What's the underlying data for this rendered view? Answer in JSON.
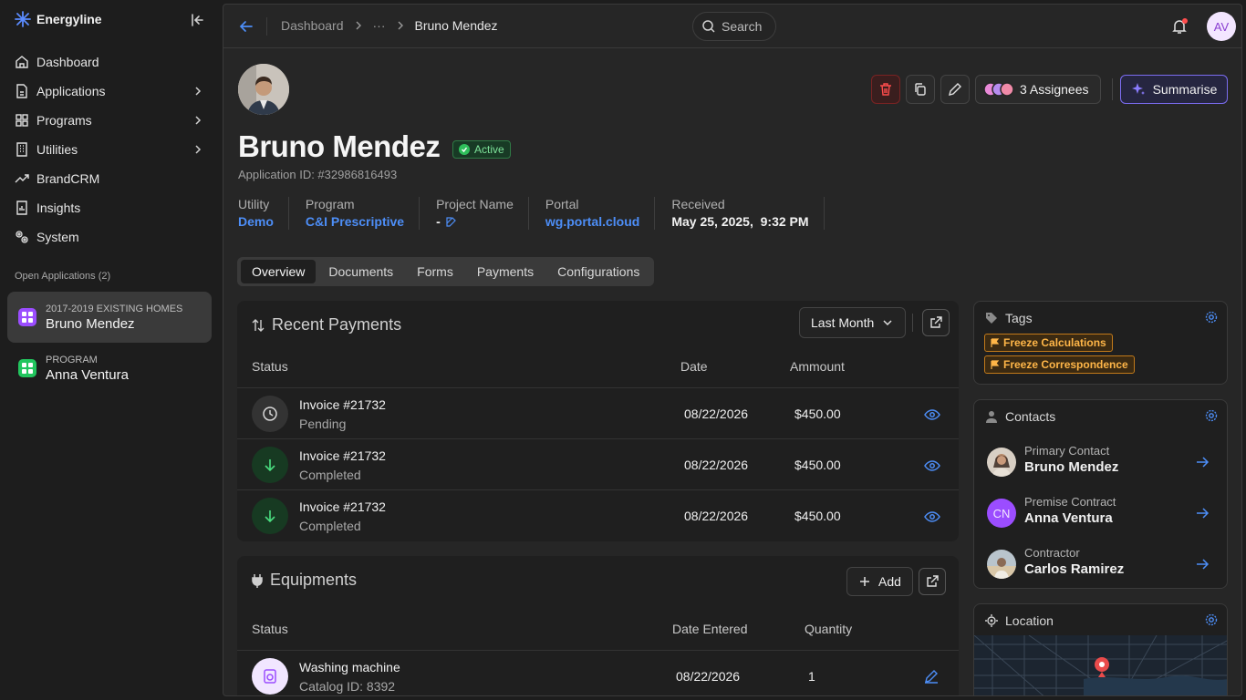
{
  "brand": {
    "name": "Energyline"
  },
  "sidebar": {
    "items": [
      {
        "label": "Dashboard",
        "icon": "home-icon",
        "has_children": false
      },
      {
        "label": "Applications",
        "icon": "document-icon",
        "has_children": true
      },
      {
        "label": "Programs",
        "icon": "grid-icon",
        "has_children": true
      },
      {
        "label": "Utilities",
        "icon": "building-icon",
        "has_children": true
      },
      {
        "label": "BrandCRM",
        "icon": "trend-icon",
        "has_children": false
      },
      {
        "label": "Insights",
        "icon": "report-icon",
        "has_children": false
      },
      {
        "label": "System",
        "icon": "gears-icon",
        "has_children": false
      }
    ],
    "open_title": "Open Applications (2)",
    "open_apps": [
      {
        "subtitle": "2017-2019 EXISTING HOMES",
        "name": "Bruno Mendez",
        "color": "#9b4dff",
        "active": true
      },
      {
        "subtitle": "PROGRAM",
        "name": "Anna Ventura",
        "color": "#22c55e",
        "active": false
      }
    ]
  },
  "topbar": {
    "breadcrumb": {
      "root": "Dashboard",
      "ellipsis": "···",
      "current": "Bruno Mendez"
    },
    "search": {
      "label": "Search"
    },
    "user_initials": "AV"
  },
  "profile": {
    "name": "Bruno Mendez",
    "status": "Active",
    "application_id": "Application ID: #32986816493",
    "meta": {
      "utility": {
        "label": "Utility",
        "value": "Demo"
      },
      "program": {
        "label": "Program",
        "value": "C&I Prescriptive"
      },
      "project": {
        "label": "Project Name",
        "value": "-"
      },
      "portal": {
        "label": "Portal",
        "value": "wg.portal.cloud"
      },
      "received": {
        "label": "Received",
        "value": "May 25, 2025,  9:32 PM"
      }
    }
  },
  "actions": {
    "assignees": "3 Assignees",
    "summarise": "Summarise"
  },
  "tabs": [
    "Overview",
    "Documents",
    "Forms",
    "Payments",
    "Configurations"
  ],
  "active_tab": "Overview",
  "payments": {
    "title": "Recent Payments",
    "filter": "Last Month",
    "columns": {
      "status": "Status",
      "date": "Date",
      "amount": "Ammount"
    },
    "rows": [
      {
        "invoice": "Invoice #21732",
        "status": "Pending",
        "date": "08/22/2026",
        "amount": "$450.00"
      },
      {
        "invoice": "Invoice #21732",
        "status": "Completed",
        "date": "08/22/2026",
        "amount": "$450.00"
      },
      {
        "invoice": "Invoice #21732",
        "status": "Completed",
        "date": "08/22/2026",
        "amount": "$450.00"
      }
    ]
  },
  "equipments": {
    "title": "Equipments",
    "add_label": "Add",
    "columns": {
      "status": "Status",
      "date": "Date Entered",
      "quantity": "Quantity"
    },
    "rows": [
      {
        "name": "Washing machine",
        "catalog": "Catalog ID: 8392",
        "date": "08/22/2026",
        "quantity": "1"
      }
    ]
  },
  "tags_card": {
    "title": "Tags",
    "tags": [
      "Freeze Calculations",
      "Freeze Correspondence"
    ]
  },
  "contacts_card": {
    "title": "Contacts",
    "contacts": [
      {
        "role": "Primary Contact",
        "name": "Bruno Mendez",
        "initials": ""
      },
      {
        "role": "Premise Contract",
        "name": "Anna Ventura",
        "initials": "CN"
      },
      {
        "role": "Contractor",
        "name": "Carlos Ramirez",
        "initials": ""
      }
    ]
  },
  "location_card": {
    "title": "Location"
  },
  "colors": {
    "accent": "#4d8ef7",
    "purple": "#7b6cf0",
    "success": "#22c55e",
    "warning": "#ffb648",
    "danger": "#e03131"
  }
}
